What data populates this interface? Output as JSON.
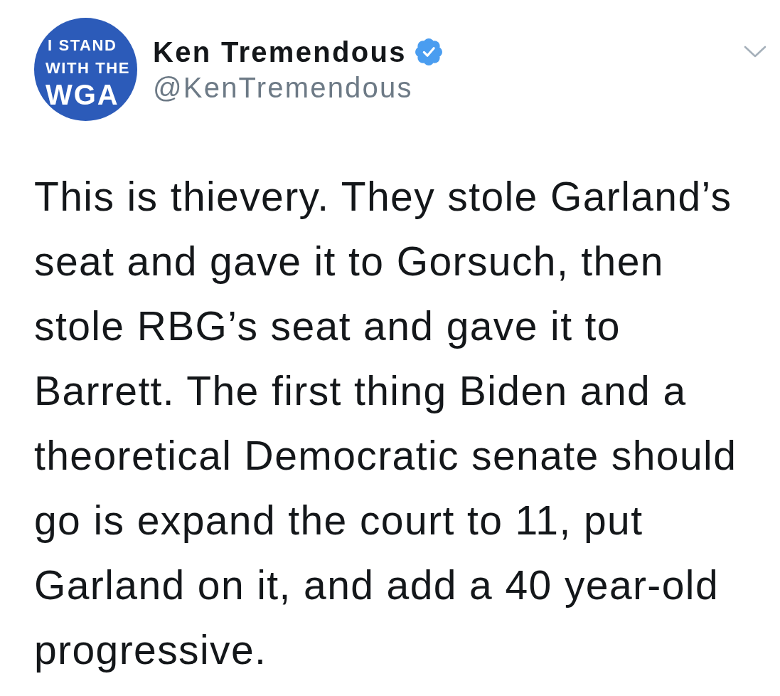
{
  "author": {
    "avatar_lines": [
      "I STAND",
      "WITH THE",
      "WGA"
    ],
    "name": "Ken Tremendous",
    "verified": true,
    "handle": "@KenTremendous"
  },
  "tweet": {
    "lines": [
      "This is thievery. They stole Garland’s",
      "seat and gave it to Gorsuch, then",
      "stole RBG’s seat and gave it to",
      "Barrett. The first thing Biden and a",
      "theoretical Democratic senate should",
      "go is expand the court to 11, put",
      "Garland on it, and add a 40 year-old",
      "progressive."
    ]
  }
}
